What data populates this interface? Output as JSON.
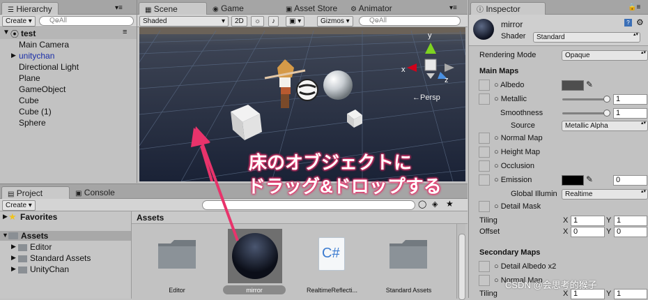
{
  "hierarchy": {
    "tab": "Hierarchy",
    "create": "Create",
    "search_placeholder": "QⱺAll",
    "scene_name": "test",
    "items": [
      "Main Camera",
      "unitychan",
      "Directional Light",
      "Plane",
      "GameObject",
      "Cube",
      "Cube (1)",
      "Sphere"
    ]
  },
  "scene": {
    "tabs": [
      "Scene",
      "Game",
      "Asset Store",
      "Animator"
    ],
    "shading": "Shaded",
    "mode_2d": "2D",
    "gizmos": "Gizmos",
    "search_placeholder": "QⱺAll",
    "persp": "←Persp",
    "axis_x": "x",
    "axis_y": "y",
    "axis_z": "z"
  },
  "annotation": {
    "line1": "床のオブジェクトに",
    "line2": "ドラッグ&ドロップする",
    "color": "#e8336b"
  },
  "project": {
    "tabs": [
      "Project",
      "Console"
    ],
    "create": "Create",
    "favorites": "Favorites",
    "assets_label": "Assets",
    "folders": [
      "Editor",
      "Standard Assets",
      "UnityChan"
    ],
    "breadcrumb": "Assets",
    "asset_items": [
      "Editor",
      "mirror",
      "RealtimeReflecti...",
      "Standard Assets"
    ]
  },
  "inspector": {
    "tab": "Inspector",
    "material_name": "mirror",
    "shader_label": "Shader",
    "shader_value": "Standard",
    "rendering_mode_label": "Rendering Mode",
    "rendering_mode_value": "Opaque",
    "main_maps": "Main Maps",
    "albedo": "Albedo",
    "metallic": "Metallic",
    "metallic_value": "1",
    "smoothness": "Smoothness",
    "smoothness_value": "1",
    "source": "Source",
    "source_value": "Metallic Alpha",
    "normal_map": "Normal Map",
    "height_map": "Height Map",
    "occlusion": "Occlusion",
    "emission": "Emission",
    "emission_value": "0",
    "global_illum": "Global Illumin",
    "global_illum_value": "Realtime",
    "detail_mask": "Detail Mask",
    "tiling": "Tiling",
    "offset": "Offset",
    "tiling_x": "1",
    "tiling_y": "1",
    "offset_x": "0",
    "offset_y": "0",
    "x_label": "X",
    "y_label": "Y",
    "secondary_maps": "Secondary Maps",
    "detail_albedo": "Detail Albedo x2",
    "normal_map2": "Normal Map",
    "tiling2": "Tiling",
    "tiling2_x": "1",
    "tiling2_y": "1"
  },
  "watermark": "CSDN @会思考的猴子"
}
